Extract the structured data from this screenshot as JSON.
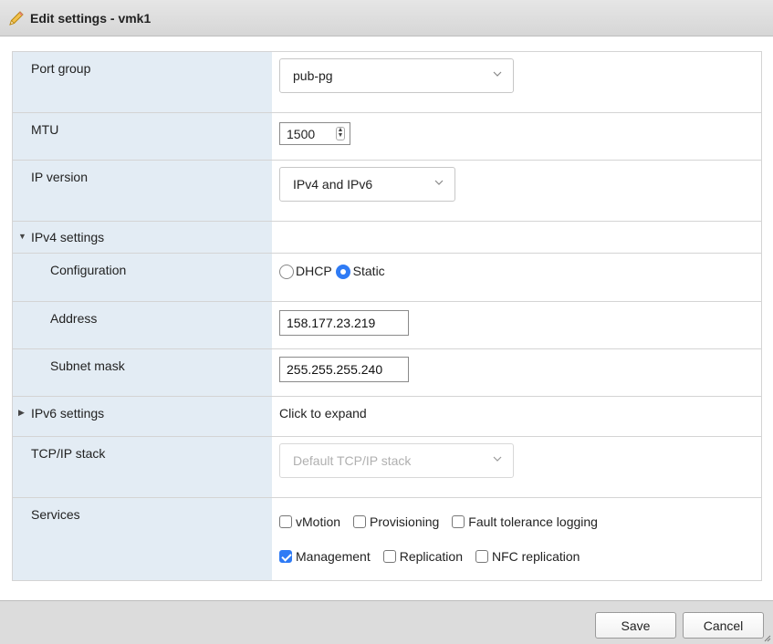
{
  "dialog": {
    "title": "Edit settings - vmk1",
    "title_icon": "pencil-icon"
  },
  "port_group": {
    "label": "Port group",
    "value": "pub-pg"
  },
  "mtu": {
    "label": "MTU",
    "value": "1500"
  },
  "ip_version": {
    "label": "IP version",
    "value": "IPv4 and IPv6"
  },
  "ipv4": {
    "section_label": "IPv4 settings",
    "expanded": true,
    "configuration": {
      "label": "Configuration",
      "options": [
        "DHCP",
        "Static"
      ],
      "selected": "Static"
    },
    "address": {
      "label": "Address",
      "value": "158.177.23.219"
    },
    "subnet_mask": {
      "label": "Subnet mask",
      "value": "255.255.255.240"
    }
  },
  "ipv6": {
    "section_label": "IPv6 settings",
    "expanded": false,
    "hint": "Click to expand"
  },
  "tcpip_stack": {
    "label": "TCP/IP stack",
    "value": "Default TCP/IP stack",
    "disabled": true
  },
  "services": {
    "label": "Services",
    "items": [
      {
        "label": "vMotion",
        "checked": false
      },
      {
        "label": "Provisioning",
        "checked": false
      },
      {
        "label": "Fault tolerance logging",
        "checked": false
      },
      {
        "label": "Management",
        "checked": true
      },
      {
        "label": "Replication",
        "checked": false
      },
      {
        "label": "NFC replication",
        "checked": false
      }
    ]
  },
  "footer": {
    "save_label": "Save",
    "cancel_label": "Cancel"
  },
  "colors": {
    "accent": "#2f7bf5",
    "label_column": "#e3ecf4",
    "titlebar": "#dedede"
  }
}
